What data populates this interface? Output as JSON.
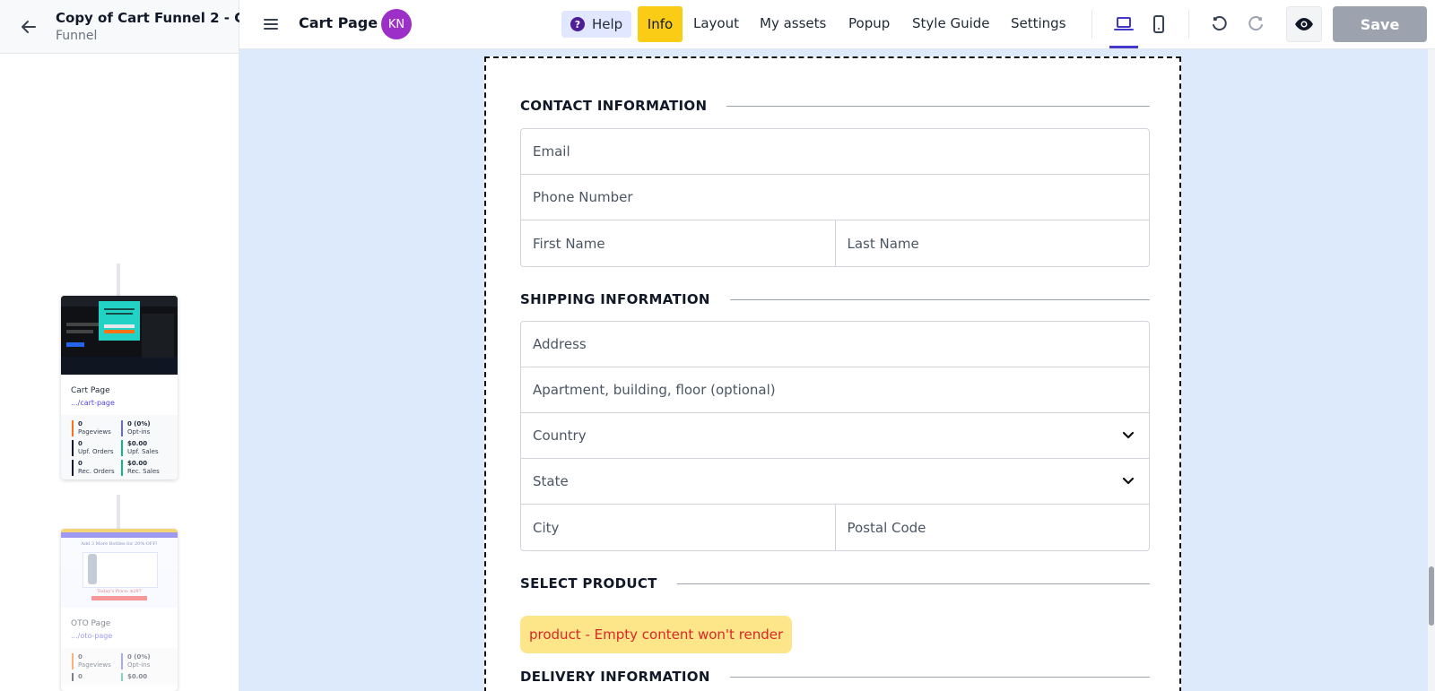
{
  "sidebar": {
    "title": "Copy of Cart Funnel 2 - C...",
    "subtitle": "Funnel",
    "steps": [
      {
        "name": "Cart Page",
        "url": ".../cart-page",
        "stats": [
          {
            "value": "0",
            "label": "Pageviews",
            "color": "#f97316"
          },
          {
            "value": "0 (0%)",
            "label": "Opt-ins",
            "color": "#6366f1"
          },
          {
            "value": "0",
            "label": "Upf. Orders",
            "color": "#111827"
          },
          {
            "value": "$0.00",
            "label": "Upf. Sales",
            "color": "#10b981"
          },
          {
            "value": "0",
            "label": "Rec. Orders",
            "color": "#111827"
          },
          {
            "value": "$0.00",
            "label": "Rec. Sales",
            "color": "#10b981"
          }
        ]
      },
      {
        "name": "OTO Page",
        "url": ".../oto-page",
        "stats": [
          {
            "value": "0",
            "label": "Pageviews",
            "color": "#f97316"
          },
          {
            "value": "0 (0%)",
            "label": "Opt-ins",
            "color": "#6366f1"
          },
          {
            "value": "0",
            "label": "",
            "color": "#111827"
          },
          {
            "value": "$0.00",
            "label": "",
            "color": "#10b981"
          }
        ],
        "thumb_heading": "Add 3 More Bottles for 20% OFF!",
        "thumb_price": "Today's Price: $297"
      }
    ]
  },
  "topbar": {
    "page_name": "Cart Page",
    "avatar_initials": "KN",
    "help_label": "Help",
    "info_label": "Info",
    "nav": [
      "Layout",
      "My assets",
      "Popup",
      "Style Guide",
      "Settings"
    ],
    "save_label": "Save"
  },
  "form": {
    "contact_heading": "CONTACT INFORMATION",
    "email": "Email",
    "phone": "Phone Number",
    "first_name": "First Name",
    "last_name": "Last Name",
    "shipping_heading": "SHIPPING INFORMATION",
    "address": "Address",
    "apartment": "Apartment, building, floor (optional)",
    "country": "Country",
    "state": "State",
    "city": "City",
    "postal": "Postal Code",
    "product_heading": "SELECT PRODUCT",
    "product_empty": "product - Empty content won't render",
    "delivery_heading": "DELIVERY INFORMATION"
  },
  "colors": {
    "canvas_bg": "#ddeafc",
    "info_yellow": "#facc15",
    "avatar_purple": "#9b2fc8",
    "accent_indigo": "#4338ca",
    "save_disabled": "#9ca3af"
  }
}
